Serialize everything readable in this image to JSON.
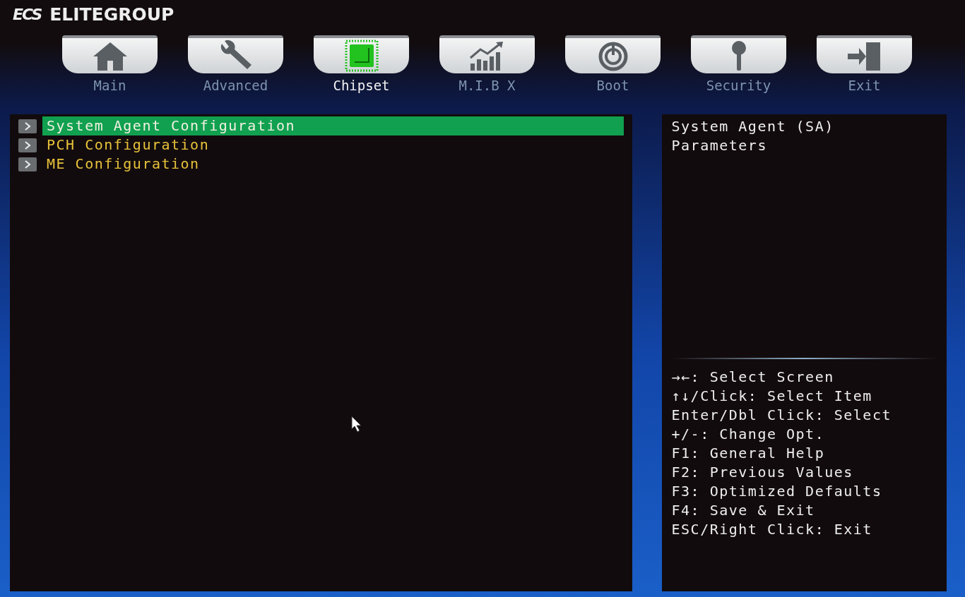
{
  "brand": {
    "logo": "ECS",
    "name": "ELITEGROUP"
  },
  "tabs": [
    {
      "label": "Main",
      "selected": false
    },
    {
      "label": "Advanced",
      "selected": false
    },
    {
      "label": "Chipset",
      "selected": true
    },
    {
      "label": "M.I.B X",
      "selected": false
    },
    {
      "label": "Boot",
      "selected": false
    },
    {
      "label": "Security",
      "selected": false
    },
    {
      "label": "Exit",
      "selected": false
    }
  ],
  "menu": [
    {
      "label": "System Agent Configuration",
      "selected": true
    },
    {
      "label": "PCH Configuration",
      "selected": false
    },
    {
      "label": "ME Configuration",
      "selected": false
    }
  ],
  "help": {
    "description": [
      "System Agent (SA)",
      "Parameters"
    ],
    "keys": [
      "→←: Select Screen",
      "↑↓/Click: Select Item",
      "Enter/Dbl Click: Select",
      "+/-: Change Opt.",
      "F1: General Help",
      "F2: Previous Values",
      "F3: Optimized Defaults",
      "F4: Save & Exit",
      "ESC/Right Click: Exit"
    ]
  }
}
